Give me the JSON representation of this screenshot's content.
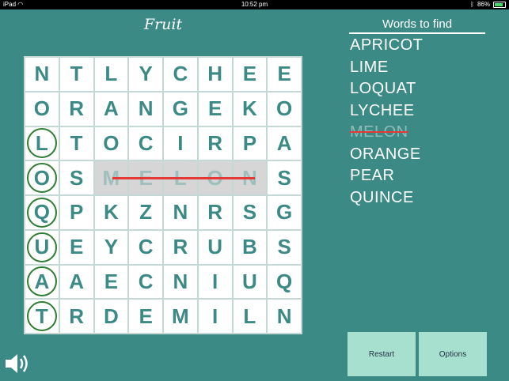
{
  "status": {
    "device": "iPad",
    "time": "10:52 pm",
    "battery": "86%",
    "battery_level": 0.86
  },
  "title": "Fruit",
  "grid": [
    [
      "N",
      "T",
      "L",
      "Y",
      "C",
      "H",
      "E",
      "E"
    ],
    [
      "O",
      "R",
      "A",
      "N",
      "G",
      "E",
      "K",
      "O"
    ],
    [
      "L",
      "T",
      "O",
      "C",
      "I",
      "R",
      "P",
      "A"
    ],
    [
      "O",
      "S",
      "M",
      "E",
      "L",
      "O",
      "N",
      "S"
    ],
    [
      "Q",
      "P",
      "K",
      "Z",
      "N",
      "R",
      "S",
      "G"
    ],
    [
      "U",
      "E",
      "Y",
      "C",
      "R",
      "U",
      "B",
      "S"
    ],
    [
      "A",
      "A",
      "E",
      "C",
      "N",
      "I",
      "U",
      "Q"
    ],
    [
      "T",
      "R",
      "D",
      "E",
      "M",
      "I",
      "L",
      "N"
    ]
  ],
  "words_header": "Words to find",
  "words": [
    {
      "text": "APRICOT",
      "found": false
    },
    {
      "text": "LIME",
      "found": false
    },
    {
      "text": "LOQUAT",
      "found": false
    },
    {
      "text": "LYCHEE",
      "found": false
    },
    {
      "text": "MELON",
      "found": true
    },
    {
      "text": "ORANGE",
      "found": false
    },
    {
      "text": "PEAR",
      "found": false
    },
    {
      "text": "QUINCE",
      "found": false
    }
  ],
  "buttons": {
    "restart": "Restart",
    "options": "Options"
  },
  "sound_icon": "speaker-icon",
  "colors": {
    "background": "#3b8a86",
    "accent": "#a8e0cf",
    "strike": "#e53935",
    "circle": "#2e7d32"
  }
}
